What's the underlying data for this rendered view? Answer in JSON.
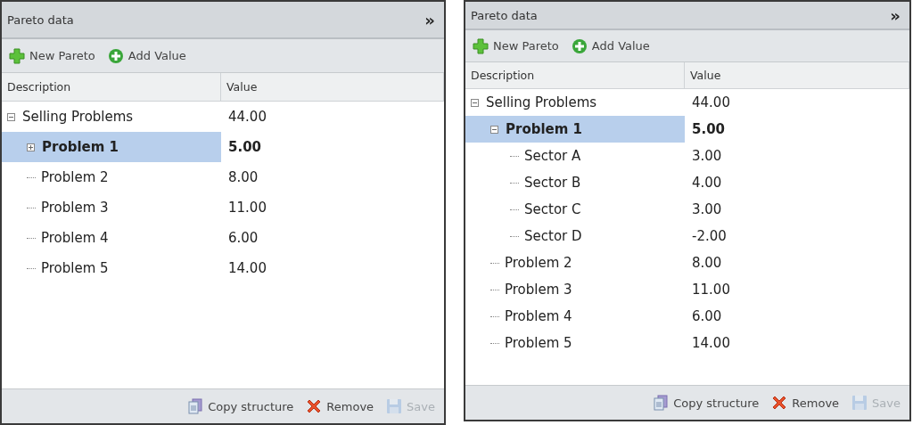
{
  "panels": [
    {
      "title": "Pareto data",
      "collapse_glyph": "»",
      "toolbar": [
        {
          "kind": "new",
          "label": "New Pareto"
        },
        {
          "kind": "add",
          "label": "Add Value"
        }
      ],
      "columns": [
        "Description",
        "Value"
      ],
      "tree": [
        {
          "label": "Selling Problems",
          "value": "44.00",
          "expanded": true,
          "selected": false,
          "children": [
            {
              "label": "Problem 1",
              "value": "5.00",
              "expanded": false,
              "selected": true,
              "has_children": true
            },
            {
              "label": "Problem 2",
              "value": "8.00",
              "selected": false
            },
            {
              "label": "Problem 3",
              "value": "11.00",
              "selected": false
            },
            {
              "label": "Problem 4",
              "value": "6.00",
              "selected": false
            },
            {
              "label": "Problem 5",
              "value": "14.00",
              "selected": false
            }
          ]
        }
      ],
      "footer": [
        {
          "kind": "copy",
          "label": "Copy structure",
          "disabled": false
        },
        {
          "kind": "remove",
          "label": "Remove",
          "disabled": false
        },
        {
          "kind": "save",
          "label": "Save",
          "disabled": true
        }
      ]
    },
    {
      "title": "Pareto data",
      "collapse_glyph": "»",
      "toolbar": [
        {
          "kind": "new",
          "label": "New Pareto"
        },
        {
          "kind": "add",
          "label": "Add Value"
        }
      ],
      "columns": [
        "Description",
        "Value"
      ],
      "tree": [
        {
          "label": "Selling Problems",
          "value": "44.00",
          "expanded": true,
          "selected": false,
          "children": [
            {
              "label": "Problem 1",
              "value": "5.00",
              "expanded": true,
              "selected": true,
              "has_children": true,
              "children": [
                {
                  "label": "Sector A",
                  "value": "3.00",
                  "selected": false
                },
                {
                  "label": "Sector B",
                  "value": "4.00",
                  "selected": false
                },
                {
                  "label": "Sector C",
                  "value": "3.00",
                  "selected": false
                },
                {
                  "label": "Sector D",
                  "value": "-2.00",
                  "selected": false
                }
              ]
            },
            {
              "label": "Problem 2",
              "value": "8.00",
              "selected": false
            },
            {
              "label": "Problem 3",
              "value": "11.00",
              "selected": false
            },
            {
              "label": "Problem 4",
              "value": "6.00",
              "selected": false
            },
            {
              "label": "Problem 5",
              "value": "14.00",
              "selected": false
            }
          ]
        }
      ],
      "footer": [
        {
          "kind": "copy",
          "label": "Copy structure",
          "disabled": false
        },
        {
          "kind": "remove",
          "label": "Remove",
          "disabled": false
        },
        {
          "kind": "save",
          "label": "Save",
          "disabled": true
        }
      ]
    }
  ]
}
